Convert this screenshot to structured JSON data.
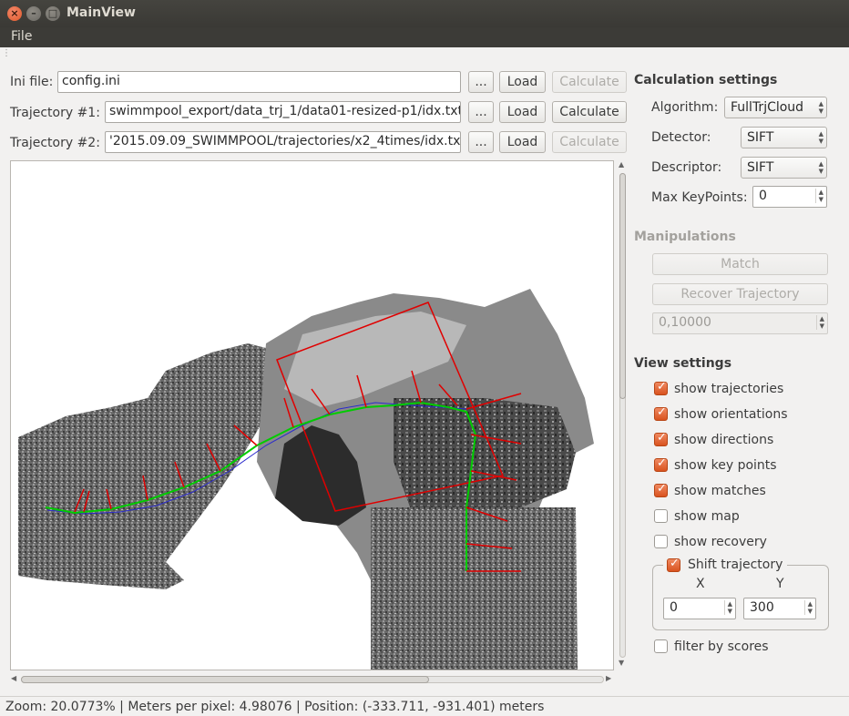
{
  "window": {
    "title": "MainView"
  },
  "menu": {
    "file_label": "File"
  },
  "files": [
    {
      "label": "Ini file:",
      "value": "config.ini",
      "browse": "...",
      "load": "Load",
      "calculate": "Calculate",
      "calc_enabled": false
    },
    {
      "label": "Trajectory #1:",
      "value": "swimmpool_export/data_trj_1/data01-resized-p1/idx.txt",
      "browse": "...",
      "load": "Load",
      "calculate": "Calculate",
      "calc_enabled": true
    },
    {
      "label": "Trajectory #2:",
      "value": "'2015.09.09_SWIMMPOOL/trajectories/x2_4times/idx.txt",
      "browse": "...",
      "load": "Load",
      "calculate": "Calculate",
      "calc_enabled": false
    }
  ],
  "calc_settings": {
    "title": "Calculation settings",
    "algorithm_label": "Algorithm:",
    "algorithm_value": "FullTrjCloud",
    "detector_label": "Detector:",
    "detector_value": "SIFT",
    "descriptor_label": "Descriptor:",
    "descriptor_value": "SIFT",
    "max_keypoints_label": "Max KeyPoints:",
    "max_keypoints_value": "0"
  },
  "manipulations": {
    "title": "Manipulations",
    "match_label": "Match",
    "recover_label": "Recover Trajectory",
    "threshold_value": "0,10000"
  },
  "view_settings": {
    "title": "View settings",
    "options": [
      {
        "label": "show trajectories",
        "checked": true
      },
      {
        "label": "show orientations",
        "checked": true
      },
      {
        "label": "show directions",
        "checked": true
      },
      {
        "label": "show key points",
        "checked": true
      },
      {
        "label": "show matches",
        "checked": true
      },
      {
        "label": "show map",
        "checked": false
      },
      {
        "label": "show recovery",
        "checked": false
      }
    ],
    "shift": {
      "label": "Shift trajectory",
      "checked": true,
      "x_label": "X",
      "y_label": "Y",
      "x_value": "0",
      "y_value": "300"
    },
    "filter": {
      "label": "filter by scores",
      "checked": false
    }
  },
  "status": {
    "text": "Zoom: 20.0773% | Meters per pixel: 4.98076 | Position: (-333.711, -931.401) meters"
  },
  "colors": {
    "accent": "#e0592a",
    "titlebar": "#3c3b37",
    "trajectory1": "#00cc00",
    "trajectory2": "#2b2bcc",
    "orientation": "#e00000",
    "match_box": "#e00000"
  }
}
